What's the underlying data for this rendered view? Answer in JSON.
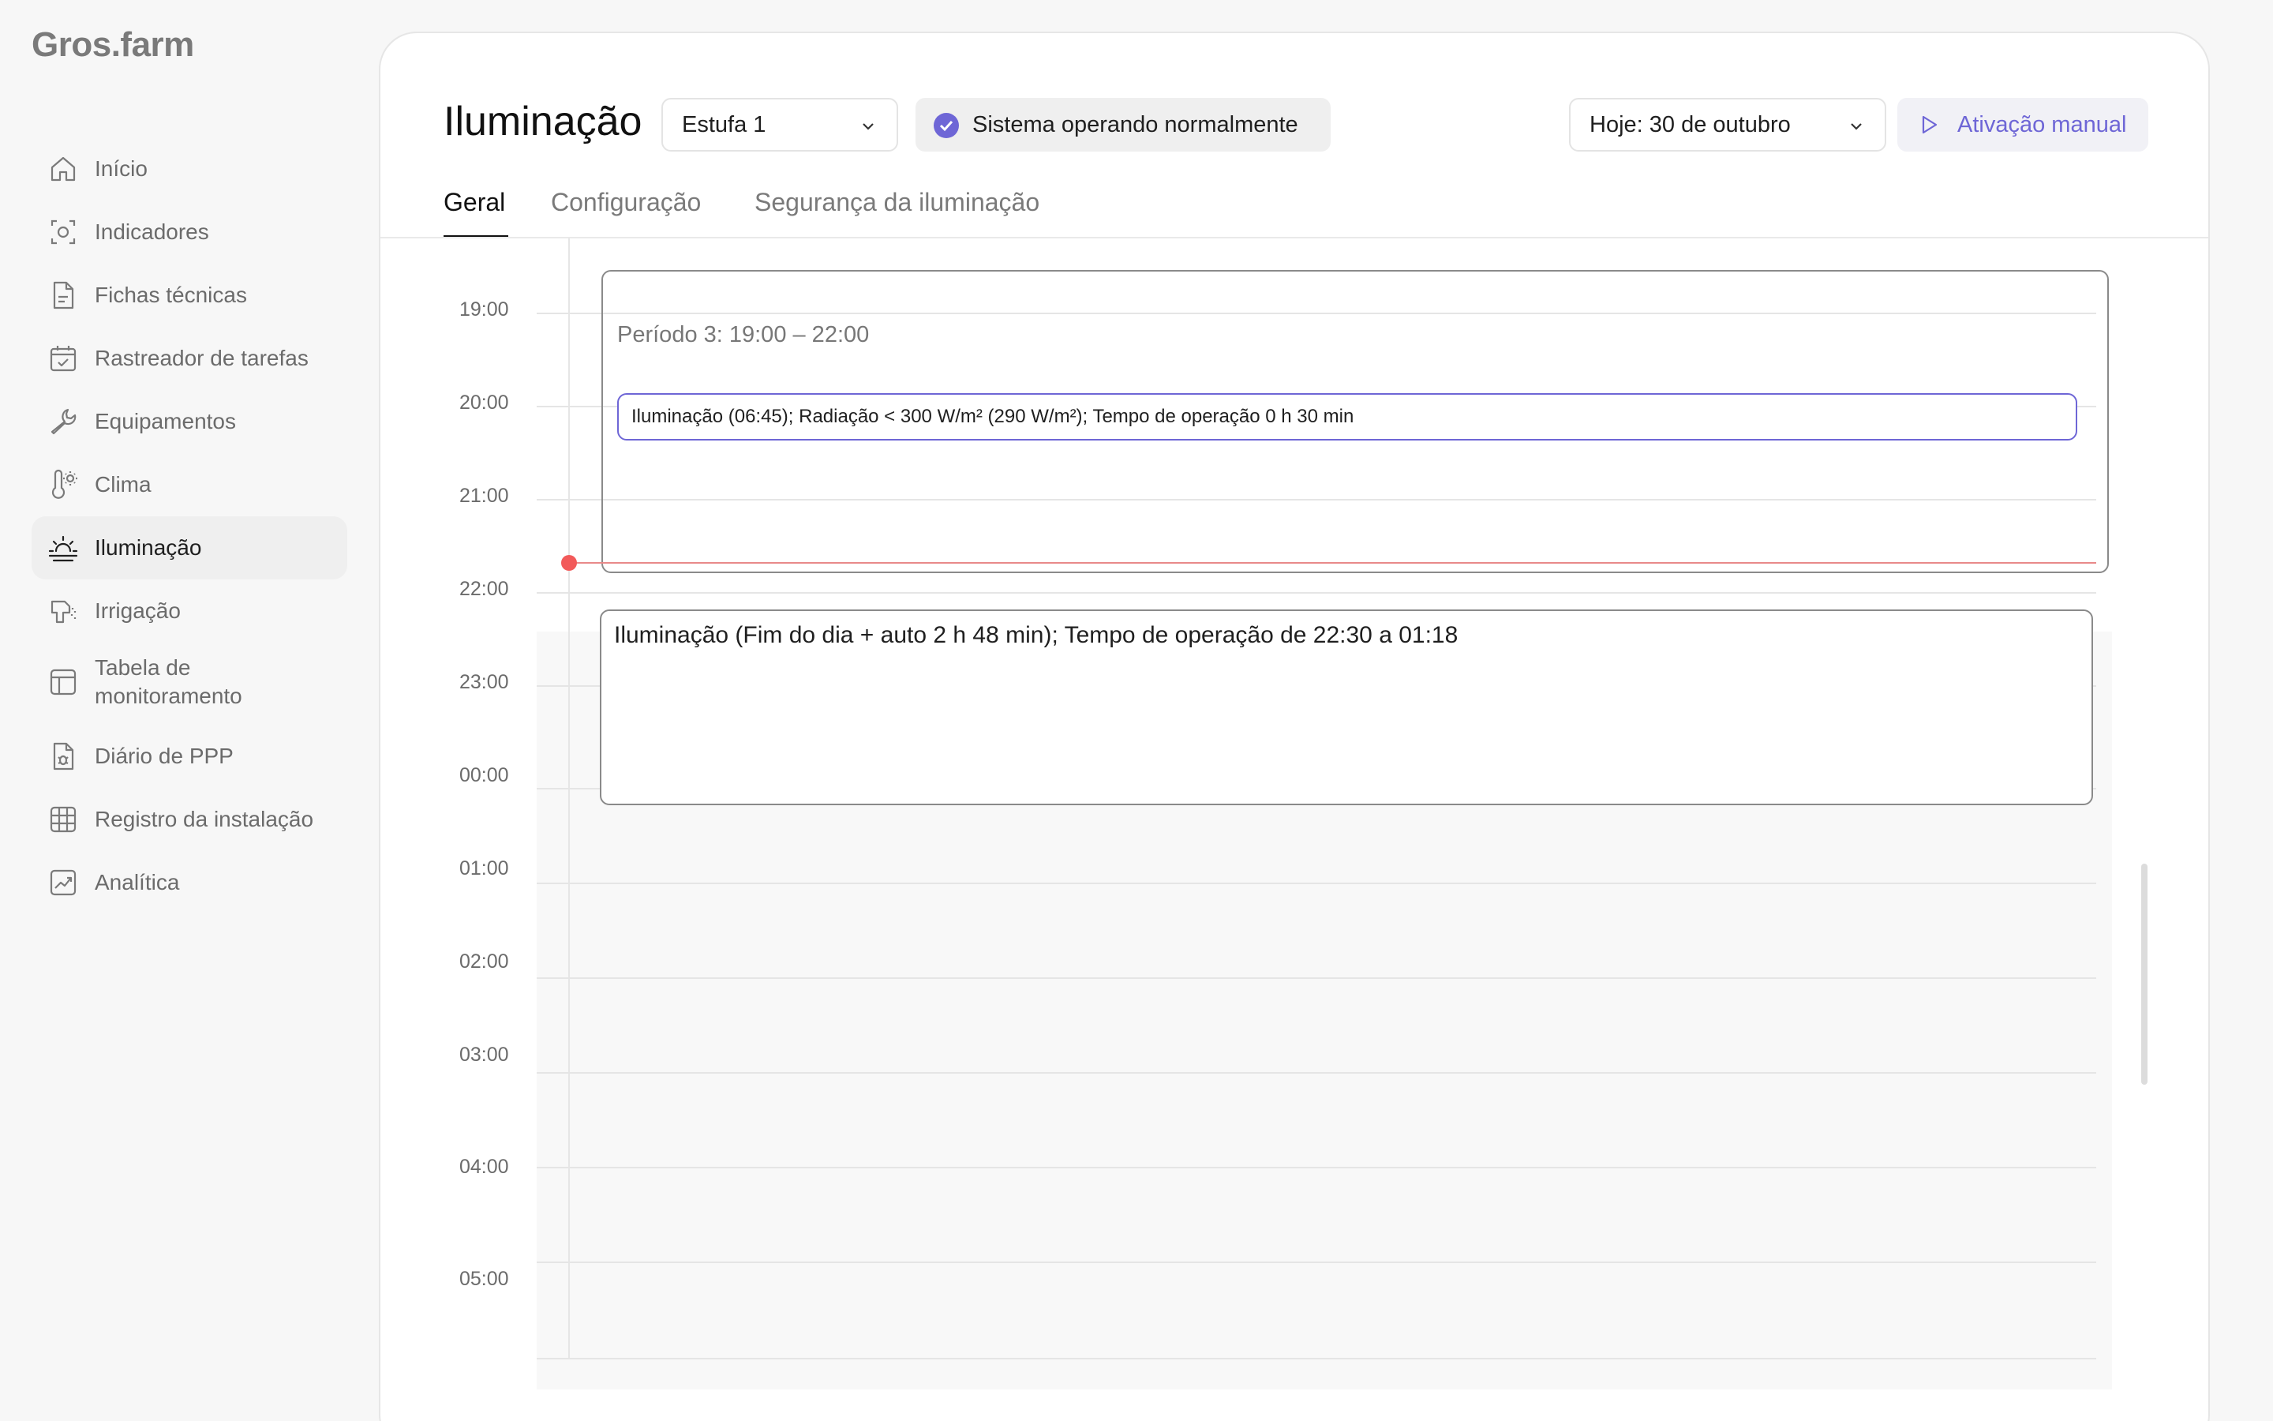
{
  "app": {
    "logo": "Gros.farm"
  },
  "sidebar": {
    "items": [
      {
        "label": "Início",
        "icon": "home-icon"
      },
      {
        "label": "Indicadores",
        "icon": "indicators-icon"
      },
      {
        "label": "Fichas técnicas",
        "icon": "document-icon"
      },
      {
        "label": "Rastreador de tarefas",
        "icon": "calendar-check-icon"
      },
      {
        "label": "Equipamentos",
        "icon": "wrench-icon"
      },
      {
        "label": "Clima",
        "icon": "thermometer-icon"
      },
      {
        "label": "Iluminação",
        "icon": "sunrise-icon",
        "active": true
      },
      {
        "label": "Irrigação",
        "icon": "irrigation-icon"
      },
      {
        "label": "Tabela de monitoramento",
        "icon": "table-icon"
      },
      {
        "label": "Diário de PPP",
        "icon": "bug-document-icon"
      },
      {
        "label": "Registro da instalação",
        "icon": "grid-icon"
      },
      {
        "label": "Analítica",
        "icon": "chart-icon"
      }
    ]
  },
  "header": {
    "title": "Iluminação",
    "greenhouse_select": "Estufa 1",
    "status": "Sistema operando normalmente",
    "date_select": "Hoje: 30 de outubro",
    "manual_button": "Ativação manual"
  },
  "tabs": [
    {
      "label": "Geral",
      "active": true
    },
    {
      "label": "Configuração"
    },
    {
      "label": "Segurança da iluminação"
    }
  ],
  "timeline": {
    "hours": [
      "19:00",
      "20:00",
      "21:00",
      "22:00",
      "23:00",
      "00:00",
      "01:00",
      "02:00",
      "03:00",
      "04:00",
      "05:00"
    ],
    "period_title": "Período 3: 19:00 – 22:00",
    "event_small": "Iluminação (06:45); Radiação < 300 W/m² (290 W/m²); Tempo de operação 0 h 30 min",
    "event_large": "Iluminação (Fim do dia + auto 2 h 48 min); Tempo de operação de 22:30 a 01:18"
  },
  "colors": {
    "accent": "#6e66d6",
    "now_line": "#f25a5a",
    "background": "#f7f7f7"
  }
}
